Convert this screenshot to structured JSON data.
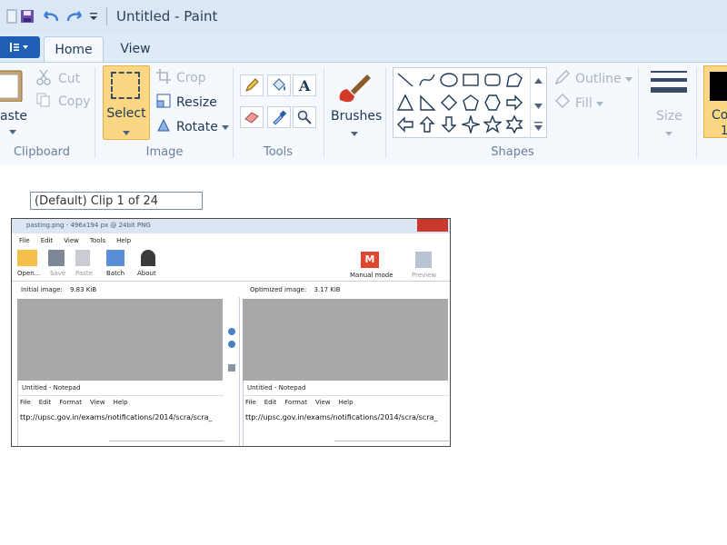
{
  "window": {
    "title": "Untitled - Paint"
  },
  "qat": {
    "icons": [
      "save-icon",
      "undo-icon",
      "redo-icon",
      "customize-chevron-icon"
    ]
  },
  "tabs": [
    {
      "label": "Home",
      "active": true
    },
    {
      "label": "View",
      "active": false
    }
  ],
  "ribbon": {
    "clipboard": {
      "label": "Clipboard",
      "paste": "aste",
      "cut": "Cut",
      "copy": "Copy"
    },
    "image": {
      "label": "Image",
      "select": "Select",
      "crop": "Crop",
      "resize": "Resize",
      "rotate": "Rotate"
    },
    "tools": {
      "label": "Tools"
    },
    "brushes": {
      "label": "Brushes"
    },
    "shapes": {
      "label": "Shapes",
      "outline": "Outline",
      "fill": "Fill"
    },
    "size": {
      "label": "Size"
    },
    "colors": {
      "color1": "Co",
      "color1_sub": "1"
    }
  },
  "canvas": {
    "clip_label": "(Default) Clip 1 of 24",
    "screenshot": {
      "title": "pasting.png - 496x194 px @ 24bit PNG",
      "menu": [
        "File",
        "Edit",
        "View",
        "Tools",
        "Help"
      ],
      "toolbar": [
        "Open...",
        "Save",
        "Paste",
        "Batch",
        "About"
      ],
      "manual_mode": "Manual mode",
      "manual_mode_icon": "M",
      "preview": "Preview",
      "initial_label": "Initial image:",
      "initial_size": "9.83 KiB",
      "optimized_label": "Optimized image:",
      "optimized_size": "3.17 KiB",
      "notepad_title": "Untitled - Notepad",
      "notepad_menu": [
        "File",
        "Edit",
        "Format",
        "View",
        "Help"
      ],
      "url_text": "ttp://upsc.gov.in/exams/notifications/2014/scra/scra_"
    }
  },
  "colors": {
    "accent_blue": "#1e5fb4",
    "select_highlight": "#fbd784",
    "ribbon_bg": "#f5f8fc"
  }
}
